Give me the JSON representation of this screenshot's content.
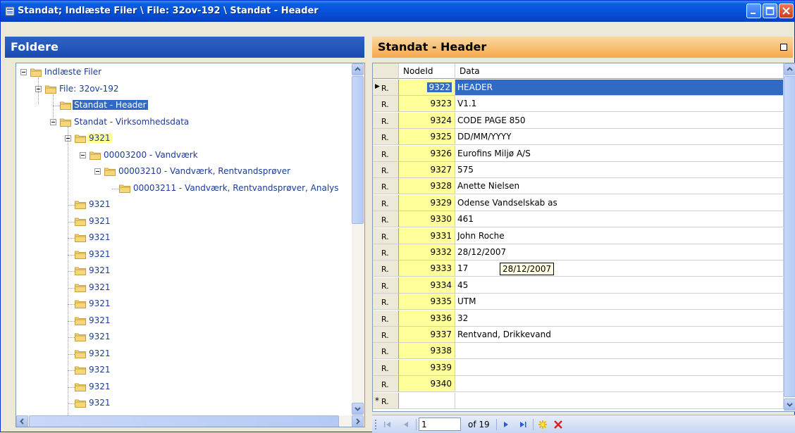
{
  "window": {
    "title": "Standat; Indlæste Filer \\ File: 32ov-192 \\ Standat - Header"
  },
  "left_panel": {
    "header": "Foldere",
    "tree": [
      {
        "label": "Indlæste Filer",
        "level": 0,
        "expanded": true
      },
      {
        "label": "File: 32ov-192",
        "level": 1,
        "expanded": true
      },
      {
        "label": "Standat - Header",
        "level": 2,
        "selected": true
      },
      {
        "label": "Standat - Virksomhedsdata",
        "level": 2,
        "expanded": true
      },
      {
        "label": "9321",
        "level": 3,
        "expanded": true,
        "highlighted": true
      },
      {
        "label": "00003200 - Vandværk",
        "level": 4,
        "expanded": true
      },
      {
        "label": "00003210 - Vandværk, Rentvandsprøver",
        "level": 5,
        "expanded": true
      },
      {
        "label": "00003211 - Vandværk, Rentvandsprøver, Analys",
        "level": 6
      },
      {
        "label": "9321",
        "level": 3
      },
      {
        "label": "9321",
        "level": 3
      },
      {
        "label": "9321",
        "level": 3
      },
      {
        "label": "9321",
        "level": 3
      },
      {
        "label": "9321",
        "level": 3
      },
      {
        "label": "9321",
        "level": 3
      },
      {
        "label": "9321",
        "level": 3
      },
      {
        "label": "9321",
        "level": 3
      },
      {
        "label": "9321",
        "level": 3
      },
      {
        "label": "9321",
        "level": 3
      },
      {
        "label": "9321",
        "level": 3
      },
      {
        "label": "9321",
        "level": 3
      },
      {
        "label": "9321",
        "level": 3
      }
    ]
  },
  "right_panel": {
    "header": "Standat - Header",
    "columns": {
      "id": "NodeId",
      "data": "Data"
    },
    "rows": [
      {
        "sel": "R.",
        "id": "9322",
        "data": "HEADER"
      },
      {
        "sel": "R.",
        "id": "9323",
        "data": "V1.1"
      },
      {
        "sel": "R.",
        "id": "9324",
        "data": "CODE PAGE 850"
      },
      {
        "sel": "R.",
        "id": "9325",
        "data": "DD/MM/YYYY"
      },
      {
        "sel": "R.",
        "id": "9326",
        "data": "Eurofins Miljø A/S"
      },
      {
        "sel": "R.",
        "id": "9327",
        "data": "575"
      },
      {
        "sel": "R.",
        "id": "9328",
        "data": "Anette Nielsen"
      },
      {
        "sel": "R.",
        "id": "9329",
        "data": "Odense Vandselskab as"
      },
      {
        "sel": "R.",
        "id": "9330",
        "data": "461"
      },
      {
        "sel": "R.",
        "id": "9331",
        "data": "John Roche"
      },
      {
        "sel": "R.",
        "id": "9332",
        "data": "28/12/2007"
      },
      {
        "sel": "R.",
        "id": "9333",
        "data": "17"
      },
      {
        "sel": "R.",
        "id": "9334",
        "data": "45"
      },
      {
        "sel": "R.",
        "id": "9335",
        "data": "UTM"
      },
      {
        "sel": "R.",
        "id": "9336",
        "data": "32"
      },
      {
        "sel": "R.",
        "id": "9337",
        "data": "Rentvand, Drikkevand"
      },
      {
        "sel": "R.",
        "id": "9338",
        "data": ""
      },
      {
        "sel": "R.",
        "id": "9339",
        "data": ""
      },
      {
        "sel": "R.",
        "id": "9340",
        "data": ""
      },
      {
        "sel": "R.",
        "id": "",
        "data": ""
      }
    ],
    "current_row_marker": "▶",
    "new_row_marker": "*",
    "tooltip": "28/12/2007"
  },
  "navigator": {
    "position": "1",
    "of_label": "of 19"
  }
}
